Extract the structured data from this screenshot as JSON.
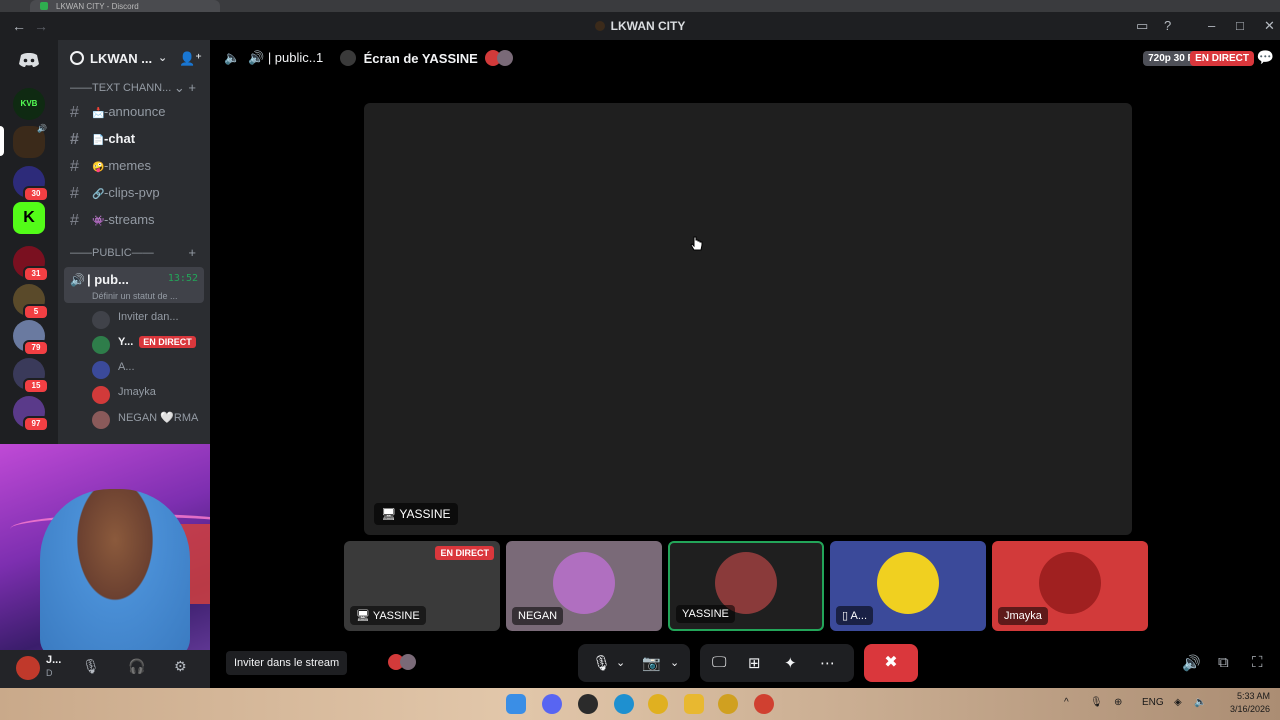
{
  "window": {
    "title": "LKWAN CITY",
    "browser_tab": "LKWAN CITY - Discord"
  },
  "guilds": {
    "items": [
      {
        "name": "discord-home",
        "badge": ""
      },
      {
        "name": "kvb",
        "badge": ""
      },
      {
        "name": "lkwan-city",
        "badge": ""
      },
      {
        "name": "server-3",
        "badge": "30"
      },
      {
        "name": "kick",
        "badge": ""
      },
      {
        "name": "server-5",
        "badge": "31"
      },
      {
        "name": "server-6",
        "badge": "5"
      },
      {
        "name": "server-7",
        "badge": "79"
      },
      {
        "name": "server-8",
        "badge": "15"
      },
      {
        "name": "server-9",
        "badge": "97"
      }
    ]
  },
  "sidebar": {
    "server_name": "LKWAN ...",
    "text_category": "——TEXT CHANN...",
    "channels": [
      {
        "emoji": "📩",
        "label": "-announce"
      },
      {
        "emoji": "📄",
        "label": "-chat"
      },
      {
        "emoji": "🤪",
        "label": "-memes"
      },
      {
        "emoji": "🔗",
        "label": "-clips-pvp"
      },
      {
        "emoji": "👾",
        "label": "-streams"
      }
    ],
    "voice_category": "——public——",
    "voice_channel": {
      "name": "| pub...",
      "timer": "13:52",
      "status": "Définir un statut de ..."
    },
    "voice_users": [
      {
        "name": "Inviter dan...",
        "live": ""
      },
      {
        "name": "Y...",
        "live": "EN DIRECT"
      },
      {
        "name": "A...",
        "live": ""
      },
      {
        "name": "Jmayka",
        "live": ""
      },
      {
        "name": "NEGAN 🤍RMA",
        "live": ""
      }
    ]
  },
  "user_panel": {
    "name": "J...",
    "tag": "D"
  },
  "call": {
    "channel_name": "| public..1",
    "screen_title": "Écran de YASSINE",
    "quality": "720p 30 FPS",
    "live": "EN DIRECT",
    "stage_label": "YASSINE",
    "tiles": [
      {
        "label": "YASSINE",
        "live": "EN DIRECT",
        "color": "#3a3a3a"
      },
      {
        "label": "NEGAN",
        "live": "",
        "color": "#7a6a78"
      },
      {
        "label": "YASSINE",
        "live": "",
        "color": "#1f1f1f"
      },
      {
        "label": "A...",
        "live": "",
        "color": "#3b4a9a"
      },
      {
        "label": "Jmayka",
        "live": "",
        "color": "#d23a3a"
      }
    ],
    "invite_button": "Inviter dans le stream"
  },
  "taskbar": {
    "lang": "ENG",
    "time": "5:33 AM",
    "date": "3/16/2026"
  },
  "colors": {
    "accent": "#5865f2",
    "live": "#da373c",
    "online": "#23a559"
  }
}
